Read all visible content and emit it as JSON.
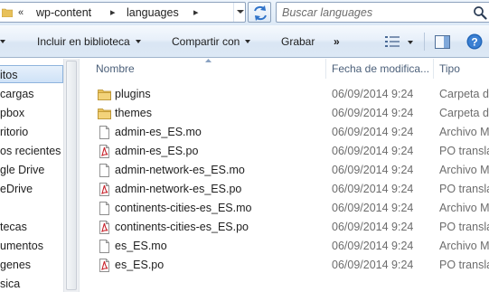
{
  "address_bar": {
    "breadcrumbs": [
      "wp-content",
      "languages"
    ],
    "search_placeholder": "Buscar languages"
  },
  "command_bar": {
    "include_library": "Incluir en biblioteca",
    "share_with": "Compartir con",
    "burn": "Grabar",
    "more": "»"
  },
  "nav_pane": {
    "items": [
      {
        "label": "itos",
        "selected": true
      },
      {
        "label": "cargas"
      },
      {
        "label": "pbox"
      },
      {
        "label": "ritorio"
      },
      {
        "label": "os recientes"
      },
      {
        "label": "gle Drive"
      },
      {
        "label": "eDrive"
      },
      {
        "label": ""
      },
      {
        "label": "tecas"
      },
      {
        "label": "umentos"
      },
      {
        "label": "genes"
      },
      {
        "label": "sica"
      }
    ]
  },
  "file_list": {
    "columns": {
      "name": "Nombre",
      "date": "Fecha de modifica...",
      "type": "Tipo"
    },
    "rows": [
      {
        "icon": "folder-icon",
        "name": "plugins",
        "date": "06/09/2014 9:24",
        "type": "Carpeta de"
      },
      {
        "icon": "folder-icon",
        "name": "themes",
        "date": "06/09/2014 9:24",
        "type": "Carpeta de"
      },
      {
        "icon": "mo-file-icon",
        "name": "admin-es_ES.mo",
        "date": "06/09/2014 9:24",
        "type": "Archivo M"
      },
      {
        "icon": "po-file-icon",
        "name": "admin-es_ES.po",
        "date": "06/09/2014 9:24",
        "type": "PO transla"
      },
      {
        "icon": "mo-file-icon",
        "name": "admin-network-es_ES.mo",
        "date": "06/09/2014 9:24",
        "type": "Archivo M"
      },
      {
        "icon": "po-file-icon",
        "name": "admin-network-es_ES.po",
        "date": "06/09/2014 9:24",
        "type": "PO transla"
      },
      {
        "icon": "mo-file-icon",
        "name": "continents-cities-es_ES.mo",
        "date": "06/09/2014 9:24",
        "type": "Archivo M"
      },
      {
        "icon": "po-file-icon",
        "name": "continents-cities-es_ES.po",
        "date": "06/09/2014 9:24",
        "type": "PO transla"
      },
      {
        "icon": "mo-file-icon",
        "name": "es_ES.mo",
        "date": "06/09/2014 9:24",
        "type": "Archivo M"
      },
      {
        "icon": "po-file-icon",
        "name": "es_ES.po",
        "date": "06/09/2014 9:24",
        "type": "PO transla"
      }
    ]
  },
  "colors": {
    "accent": "#1e5aa8",
    "header_text": "#4c607a",
    "folder": "#e8c15a",
    "pdf_red": "#c8232c"
  }
}
